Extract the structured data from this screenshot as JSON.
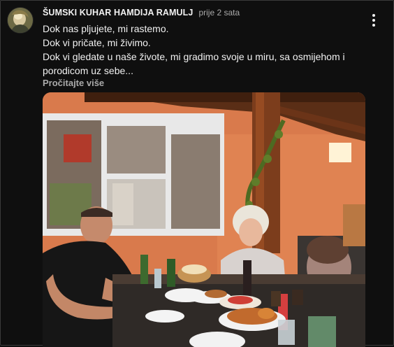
{
  "post": {
    "author": "ŠUMSKI KUHAR HAMDIJA RAMULJ",
    "time": "prije 2 sata",
    "lines": [
      "Dok nas pljujete, mi rastemo.",
      "Dok vi pričate, mi živimo.",
      "Dok vi gledate u naše živote, mi gradimo svoje u miru, sa osmijehom i porodicom uz sebe..."
    ],
    "read_more": "Pročitajte više"
  },
  "icons": {
    "avatar": "profile-avatar",
    "menu": "more-vertical-icon"
  },
  "colors": {
    "background": "#0f0f0f",
    "text_primary": "#f1f1f1",
    "text_secondary": "#aaaaaa",
    "photo_wall": "#d9774a"
  }
}
